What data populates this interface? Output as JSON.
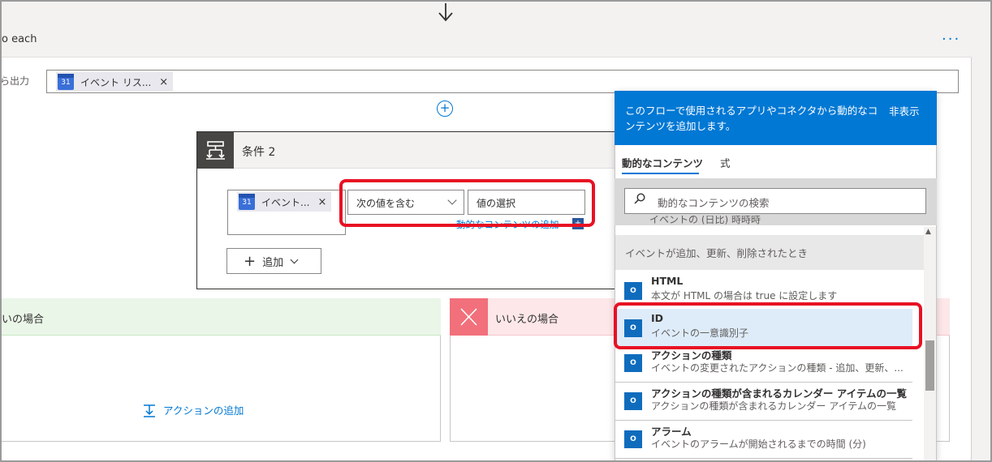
{
  "foreach": {
    "title": "o each",
    "more": "···",
    "output_label": "ら出力",
    "token_label": "イベント リス...",
    "token_close": "×",
    "calendar_glyph": "31"
  },
  "condition": {
    "title": "条件 2",
    "left_token": "イベント...",
    "left_close": "×",
    "operator": "次の値を含む",
    "value_placeholder": "値の選択",
    "dynamic_link": "動的なコンテンツの追加",
    "add_label": "追加"
  },
  "branches": {
    "yes_label": "いの場合",
    "no_label": "いいえの場合",
    "add_action": "アクションの追加"
  },
  "panel": {
    "description": "このフローで使用されるアプリやコネクタから動的なコンテンツを追加します。",
    "hide": "非表示",
    "tab_dynamic": "動的なコンテンツ",
    "tab_expression": "式",
    "search_placeholder": "動的なコンテンツの検索",
    "cut_text": "イベントの (日比) 時時時",
    "section": "イベントが追加、更新、削除されたとき",
    "items": [
      {
        "title": "HTML",
        "desc": "本文が HTML の場合は true に設定します"
      },
      {
        "title": "ID",
        "desc": "イベントの一意識別子"
      },
      {
        "title": "アクションの種類",
        "desc": "イベントの変更されたアクションの種類 - 追加、更新、..."
      },
      {
        "title": "アクションの種類が含まれるカレンダー アイテムの一覧",
        "desc": "アクションの種類が含まれるカレンダー アイテムの一覧"
      },
      {
        "title": "アラーム",
        "desc": "イベントのアラームが開始されるまでの時間 (分)"
      }
    ]
  },
  "colors": {
    "accent": "#0078d4",
    "highlight": "#e81123",
    "yes_bg": "#eaf6e8",
    "no_bg": "#fde7e9"
  }
}
